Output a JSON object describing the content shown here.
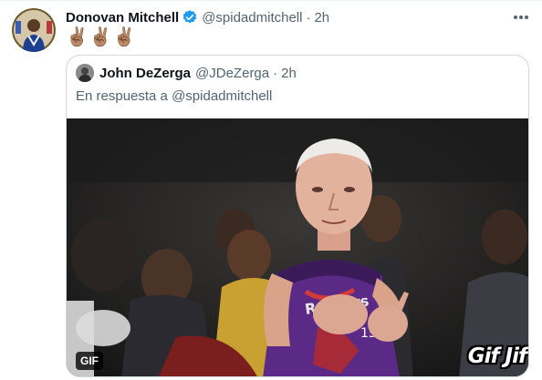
{
  "tweet": {
    "author_name": "Donovan Mitchell",
    "author_handle": "@spidadmitchell",
    "separator": "·",
    "time": "2h",
    "text": "✌🏽✌🏽✌🏽",
    "verified": true
  },
  "quote": {
    "author_name": "John DeZerga",
    "author_handle": "@JDeZerga",
    "separator": "·",
    "time": "2h",
    "reply_prefix": "En respuesta a ",
    "reply_to": "@spidadmitchell",
    "media": {
      "type": "GIF",
      "badge": "GIF",
      "watermark": "Gif Jif"
    }
  },
  "colors": {
    "verified": "#1d9bf0",
    "secondary_text": "#536471",
    "border": "#cfd9de",
    "jersey": "#5b2a86"
  }
}
